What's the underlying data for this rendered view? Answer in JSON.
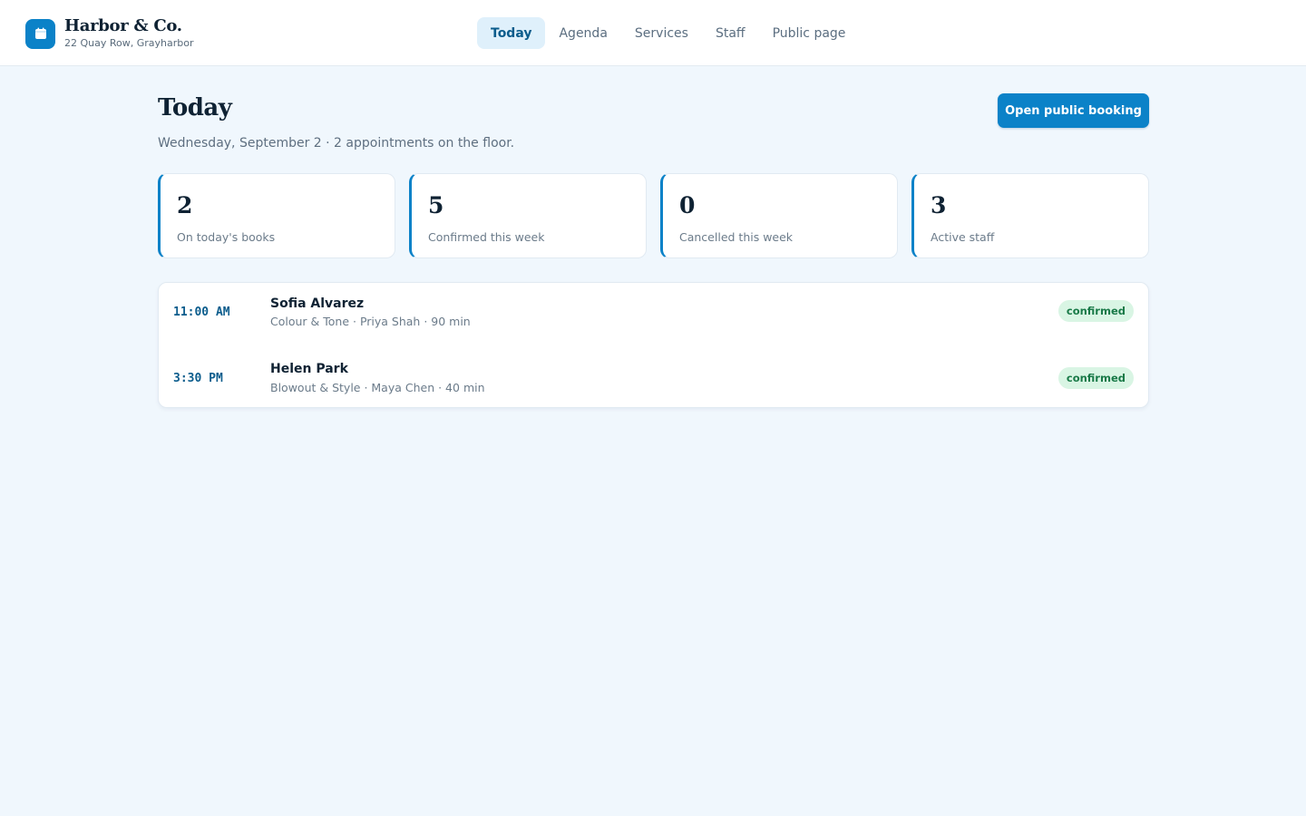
{
  "brand": {
    "name": "Harbor & Co.",
    "address": "22 Quay Row, Grayharbor",
    "logo_icon": "calendar-icon"
  },
  "nav": {
    "items": [
      {
        "label": "Today",
        "active": true
      },
      {
        "label": "Agenda",
        "active": false
      },
      {
        "label": "Services",
        "active": false
      },
      {
        "label": "Staff",
        "active": false
      },
      {
        "label": "Public page",
        "active": false
      }
    ]
  },
  "page": {
    "title": "Today",
    "subtitle": "Wednesday, September 2 · 2 appointments on the floor.",
    "cta_label": "Open public booking"
  },
  "stats": [
    {
      "value": "2",
      "label": "On today's books"
    },
    {
      "value": "5",
      "label": "Confirmed this week"
    },
    {
      "value": "0",
      "label": "Cancelled this week"
    },
    {
      "value": "3",
      "label": "Active staff"
    }
  ],
  "appointments": [
    {
      "time": "11:00 AM",
      "client": "Sofia Alvarez",
      "details": "Colour & Tone · Priya Shah · 90 min",
      "status": "confirmed"
    },
    {
      "time": "3:30 PM",
      "client": "Helen Park",
      "details": "Blowout & Style · Maya Chen · 40 min",
      "status": "confirmed"
    }
  ],
  "colors": {
    "accent": "#0b82c8",
    "background": "#f0f7fd",
    "status_confirmed_bg": "#d9f5e4",
    "status_confirmed_text": "#197a48"
  }
}
